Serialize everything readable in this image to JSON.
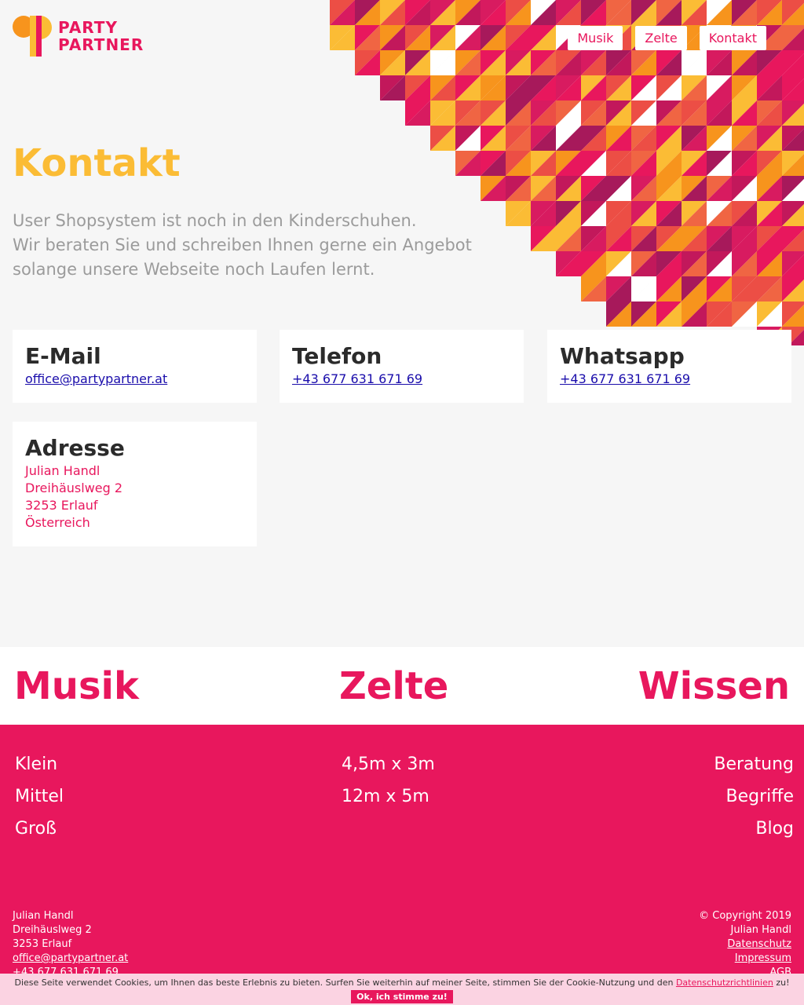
{
  "brand": {
    "line1": "PARTY",
    "line2": "PARTNER",
    "colors": {
      "pink": "#e8175d",
      "orange": "#fbbc35",
      "dark_orange": "#f7941d",
      "purple": "#a7195b"
    }
  },
  "nav": [
    {
      "label": "Musik"
    },
    {
      "label": "Zelte"
    },
    {
      "label": "Kontakt"
    }
  ],
  "page": {
    "title": "Kontakt",
    "intro": [
      "User Shopsystem ist noch in den Kinderschuhen.",
      "Wir beraten Sie und schreiben Ihnen gerne ein Angebot",
      "solange unsere Webseite noch Laufen lernt."
    ]
  },
  "cards": {
    "email": {
      "title": "E-Mail",
      "link": "office@partypartner.at"
    },
    "phone": {
      "title": "Telefon",
      "link": "+43 677 631 671 69"
    },
    "whatsapp": {
      "title": "Whatsapp",
      "link": "+43 677 631 671 69"
    },
    "address": {
      "title": "Adresse",
      "lines": [
        "Julian Handl",
        "Dreihäuslweg 2",
        "3253 Erlauf",
        "Österreich"
      ]
    }
  },
  "footer": {
    "headings": [
      "Musik",
      "Zelte",
      "Wissen"
    ],
    "musik": [
      "Klein",
      "Mittel",
      "Groß"
    ],
    "zelte": [
      "4,5m x 3m",
      "12m x 5m"
    ],
    "wissen": [
      "Beratung",
      "Begriffe",
      "Blog"
    ],
    "contact": [
      "Julian Handl",
      "Dreihäuslweg 2",
      "3253 Erlauf",
      "office@partypartner.at",
      "+43 677 631 671 69"
    ],
    "legal": {
      "copyright": "© Copyright 2019",
      "owner": "Julian Handl",
      "links": [
        "Datenschutz",
        "Impressum",
        "AGB"
      ]
    }
  },
  "cookie": {
    "text": "Diese Seite verwendet Cookies, um Ihnen das beste Erlebnis zu bieten. Surfen Sie weiterhin auf meiner Seite, stimmen Sie der Cookie-Nutzung und den",
    "link": "Datenschutzrichtlinien",
    "suffix": "zu!",
    "button": "Ok, ich stimme zu!"
  }
}
